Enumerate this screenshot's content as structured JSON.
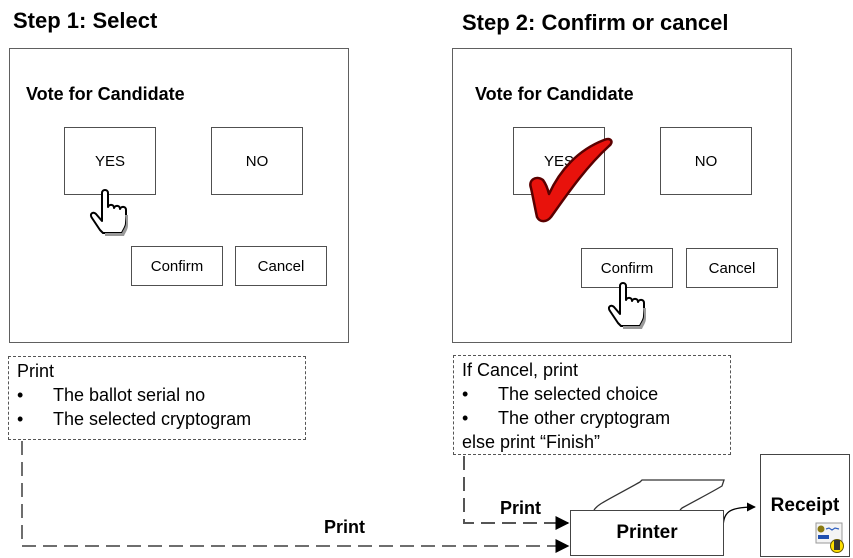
{
  "step1": {
    "title": "Step 1: Select",
    "panel_heading": "Vote for Candidate",
    "yes_label": "YES",
    "no_label": "NO",
    "confirm_label": "Confirm",
    "cancel_label": "Cancel",
    "note": {
      "heading": "Print",
      "items": [
        "The ballot serial no",
        "The selected cryptogram"
      ]
    }
  },
  "step2": {
    "title": "Step 2: Confirm or cancel",
    "panel_heading": "Vote for Candidate",
    "yes_label": "YES",
    "no_label": "NO",
    "confirm_label": "Confirm",
    "cancel_label": "Cancel",
    "note": {
      "heading": "If Cancel, print",
      "items": [
        "The selected choice",
        "The other cryptogram"
      ],
      "footer": "else print “Finish”"
    }
  },
  "flow": {
    "print_label_1": "Print",
    "print_label_2": "Print",
    "printer_label": "Printer",
    "receipt_label": "Receipt"
  },
  "bullet_glyph": "•",
  "colors": {
    "checkmark": "#e8120c",
    "checkmark_outline": "#5a0000",
    "dashed_line": "#6e6e6e"
  }
}
